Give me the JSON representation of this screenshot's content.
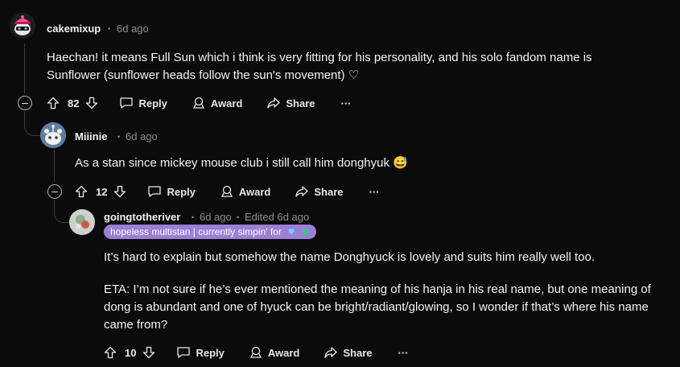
{
  "comments": [
    {
      "username": "cakemixup",
      "time": "6d ago",
      "body": "Haechan! it means Full Sun which i think is very fitting for his personality, and his solo fandom name is Sunflower (sunflower heads follow the sun's movement) ♡",
      "votes": "82",
      "reply_label": "Reply",
      "award_label": "Award",
      "share_label": "Share",
      "more_label": "···"
    },
    {
      "username": "Miiinie",
      "time": "6d ago",
      "body": "As a stan since mickey mouse club i still call him donghyuk 😅",
      "votes": "12",
      "reply_label": "Reply",
      "award_label": "Award",
      "share_label": "Share",
      "more_label": "···"
    },
    {
      "username": "goingtotheriver",
      "time": "6d ago",
      "edited": "Edited 6d ago",
      "flair": "hopeless multistan | currently simpin' for",
      "body_p1": "It’s hard to explain but somehow the name Donghyuck is lovely and suits him really well too.",
      "body_p2": "ETA: I’m not sure if he’s ever mentioned the meaning of his hanja in his real name, but one meaning of dong is abundant and one of hyuck can be bright/radiant/glowing, so I wonder if that’s where his name came from?",
      "votes": "10",
      "reply_label": "Reply",
      "award_label": "Award",
      "share_label": "Share",
      "more_label": "···"
    }
  ],
  "separator": "•",
  "colors": {
    "flair_bg": "#9b7ed6",
    "accent_meta": "#8a8f93",
    "background": "#0b0b0b"
  },
  "icons": [
    "upvote-icon",
    "downvote-icon",
    "reply-icon",
    "award-icon",
    "share-icon",
    "more-icon",
    "collapse-icon",
    "diamond-icon",
    "heart-icon"
  ]
}
